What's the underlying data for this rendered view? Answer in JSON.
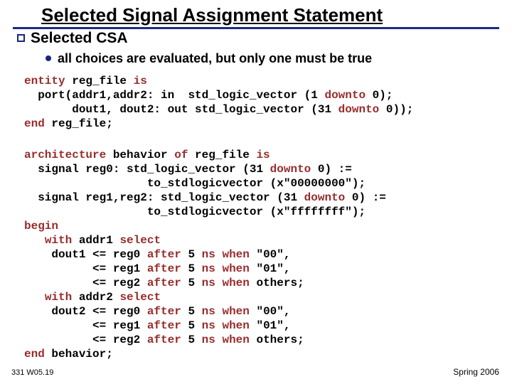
{
  "title": "Selected Signal Assignment Statement",
  "bullet1": "Selected CSA",
  "bullet2": "all choices are evaluated, but only one must be true",
  "code1": {
    "kw_entity": "entity",
    "name1": " reg_file ",
    "kw_is1": "is",
    "l2a": "  port(addr1,addr2: in  std_logic_vector (1 ",
    "kw_downto1": "downto",
    "l2b": " 0);",
    "l3a": "       dout1, dout2: out std_logic_vector (31 ",
    "kw_downto2": "downto",
    "l3b": " 0));",
    "kw_end1": "end",
    "l4": " reg_file;"
  },
  "code2": {
    "kw_arch": "architecture",
    "l1a": " behavior ",
    "kw_of": "of",
    "l1b": " reg_file ",
    "kw_is2": "is",
    "l2a": "  signal reg0: std_logic_vector (31 ",
    "kw_downto3": "downto",
    "l2b": " 0) :=",
    "l3": "                  to_stdlogicvector (x\"00000000\");",
    "l4a": "  signal reg1,reg2: std_logic_vector (31 ",
    "kw_downto4": "downto",
    "l4b": " 0) :=",
    "l5": "                  to_stdlogicvector (x\"ffffffff\");",
    "kw_begin": "begin",
    "l7a": "   ",
    "kw_with1": "with",
    "l7b": " addr1 ",
    "kw_select1": "select",
    "l8a": "    dout1 <= reg0 ",
    "kw_after1": "after",
    "l8b": " 5 ",
    "kw_ns1": "ns",
    "l8c": " ",
    "kw_when1": "when",
    "l8d": " \"00\",",
    "l9a": "          <= reg1 ",
    "kw_after2": "after",
    "l9b": " 5 ",
    "kw_ns2": "ns",
    "l9c": " ",
    "kw_when2": "when",
    "l9d": " \"01\",",
    "l10a": "          <= reg2 ",
    "kw_after3": "after",
    "l10b": " 5 ",
    "kw_ns3": "ns",
    "l10c": " ",
    "kw_when3": "when",
    "l10d": " others;",
    "l11a": "   ",
    "kw_with2": "with",
    "l11b": " addr2 ",
    "kw_select2": "select",
    "l12a": "    dout2 <= reg0 ",
    "kw_after4": "after",
    "l12b": " 5 ",
    "kw_ns4": "ns",
    "l12c": " ",
    "kw_when4": "when",
    "l12d": " \"00\",",
    "l13a": "          <= reg1 ",
    "kw_after5": "after",
    "l13b": " 5 ",
    "kw_ns5": "ns",
    "l13c": " ",
    "kw_when5": "when",
    "l13d": " \"01\",",
    "l14a": "          <= reg2 ",
    "kw_after6": "after",
    "l14b": " 5 ",
    "kw_ns6": "ns",
    "l14c": " ",
    "kw_when6": "when",
    "l14d": " others;",
    "kw_end2": "end",
    "l15": " behavior;"
  },
  "footer_left": "331 W05.19",
  "footer_right": "Spring 2006"
}
